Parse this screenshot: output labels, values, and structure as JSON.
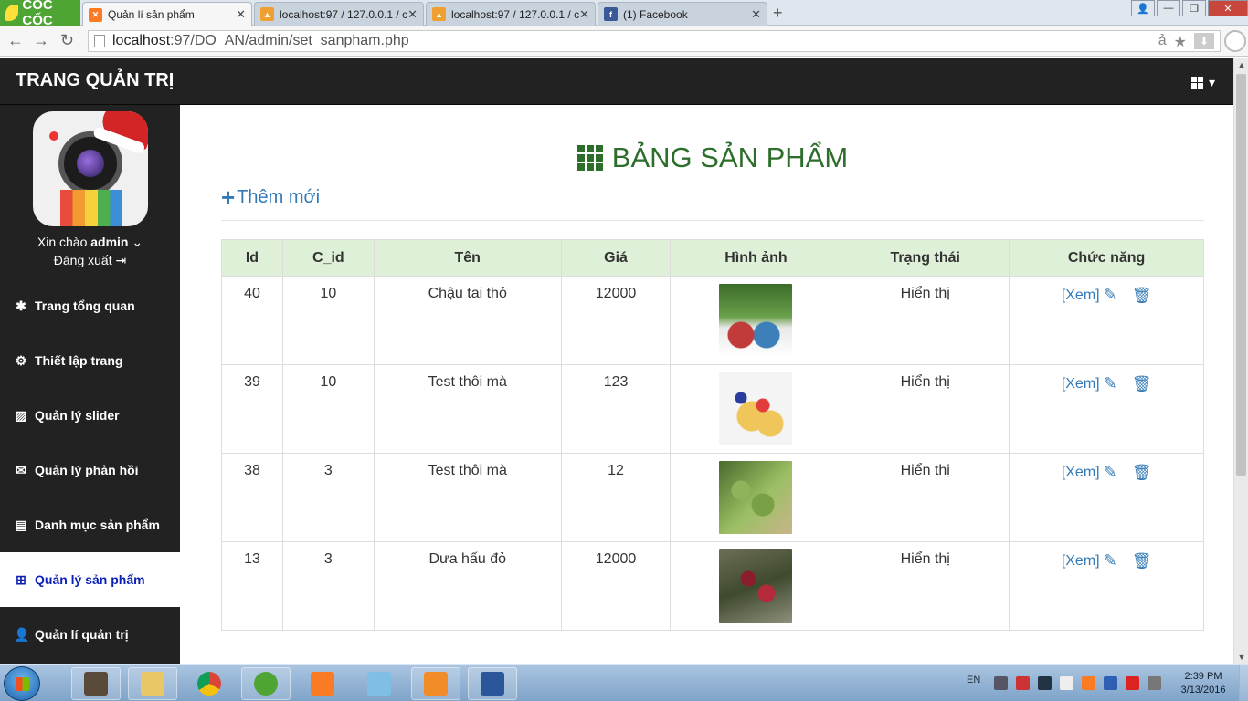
{
  "browser": {
    "brand": "CỐC CỐC",
    "tabs": [
      {
        "title": "Quản lí sản phẩm",
        "icon": "xampp-icon",
        "color": "#fb7a24",
        "active": true
      },
      {
        "title": "localhost:97 / 127.0.0.1 / c",
        "icon": "phpmyadmin-icon",
        "color": "#f0a030",
        "active": false
      },
      {
        "title": "localhost:97 / 127.0.0.1 / c",
        "icon": "phpmyadmin-icon",
        "color": "#f0a030",
        "active": false
      },
      {
        "title": "(1) Facebook",
        "icon": "facebook-icon",
        "color": "#3b5998",
        "active": false
      }
    ],
    "url_host": "localhost",
    "url_rest": ":97/DO_AN/admin/set_sanpham.php"
  },
  "header": {
    "title": "TRANG QUẢN TRỊ"
  },
  "sidebar": {
    "greeting_prefix": "Xin chào ",
    "username": "admin",
    "logout": "Đăng xuất",
    "items": [
      {
        "label": "Trang tổng quan",
        "icon": "asterisk-icon",
        "active": false
      },
      {
        "label": "Thiết lập trang",
        "icon": "cog-icon",
        "active": false
      },
      {
        "label": "Quản lý slider",
        "icon": "picture-icon",
        "active": false
      },
      {
        "label": "Quản lý phản hồi",
        "icon": "envelope-icon",
        "active": false
      },
      {
        "label": "Danh mục sản phẩm",
        "icon": "list-icon",
        "active": false
      },
      {
        "label": "Quản lý sản phẩm",
        "icon": "gift-icon",
        "active": true
      },
      {
        "label": "Quản lí quản trị",
        "icon": "user-icon",
        "active": false
      }
    ]
  },
  "main": {
    "heading": "BẢNG SẢN PHẨM",
    "add_new": "Thêm mới",
    "columns": [
      "Id",
      "C_id",
      "Tên",
      "Giá",
      "Hình ảnh",
      "Trạng thái",
      "Chức năng"
    ],
    "rows": [
      {
        "id": "40",
        "c_id": "10",
        "name": "Chậu tai thỏ",
        "price": "12000",
        "status": "Hiển thị",
        "view": "[Xem]"
      },
      {
        "id": "39",
        "c_id": "10",
        "name": "Test thôi mà",
        "price": "123",
        "status": "Hiển thị",
        "view": "[Xem]"
      },
      {
        "id": "38",
        "c_id": "3",
        "name": "Test thôi mà",
        "price": "12",
        "status": "Hiển thị",
        "view": "[Xem]"
      },
      {
        "id": "13",
        "c_id": "3",
        "name": "Dưa hấu đỏ",
        "price": "12000",
        "status": "Hiển thị",
        "view": "[Xem]"
      }
    ]
  },
  "taskbar": {
    "language": "EN",
    "time": "2:39 PM",
    "date": "3/13/2016"
  },
  "colors": {
    "accent": "#337ab7",
    "heading": "#2e6e2c",
    "active_menu_text": "#0b1fb5",
    "table_header_bg": "#dff0d8"
  }
}
